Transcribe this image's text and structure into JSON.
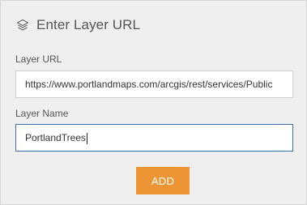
{
  "header": {
    "icon": "layers-icon",
    "title": "Enter Layer URL"
  },
  "layer_url": {
    "label": "Layer URL",
    "value": "https://www.portlandmaps.com/arcgis/rest/services/Public"
  },
  "layer_name": {
    "label": "Layer Name",
    "value": "PortlandTrees"
  },
  "actions": {
    "add_label": "ADD"
  },
  "colors": {
    "accent": "#ed9435",
    "focus_border": "#3f6fa8",
    "panel_bg": "#efefef"
  }
}
